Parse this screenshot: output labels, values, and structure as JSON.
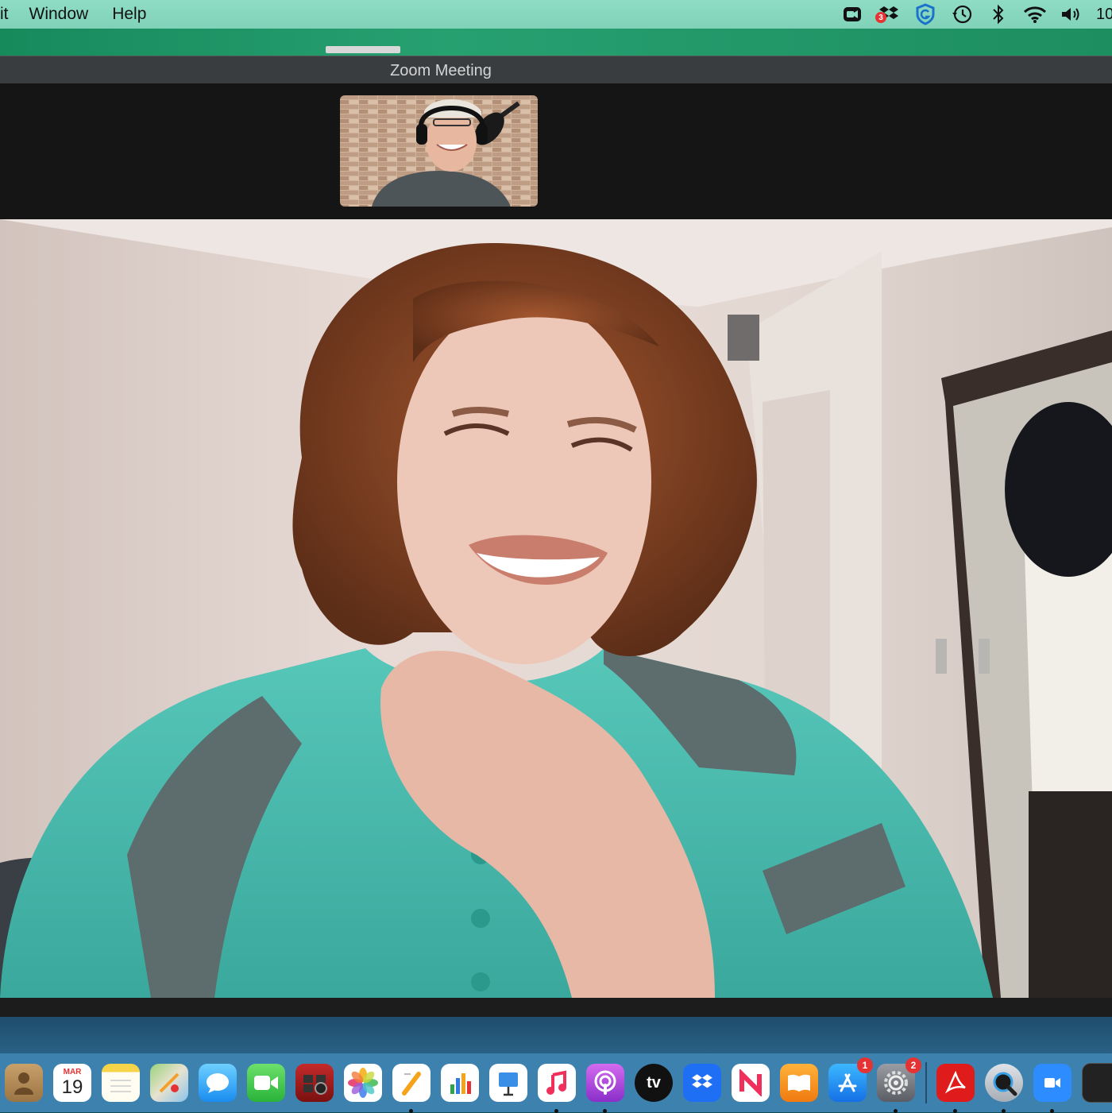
{
  "menubar": {
    "items": [
      "it",
      "Window",
      "Help"
    ],
    "status_icons": [
      "zoom-icon",
      "dropbox-icon",
      "grammarly-icon",
      "time-machine-icon",
      "bluetooth-icon",
      "wifi-icon",
      "volume-icon"
    ],
    "dropbox_badge": "3",
    "clock": "10"
  },
  "window": {
    "title": "Zoom Meeting"
  },
  "dock": {
    "calendar_month": "MAR",
    "calendar_day": "19",
    "appletv_label": "tv",
    "appstore_badge": "1",
    "settings_badge": "2"
  },
  "colors": {
    "menubar": "#8fdcc4",
    "titlebar": "#3a3d3f",
    "strip": "#151515",
    "dock": "#468cbe"
  }
}
